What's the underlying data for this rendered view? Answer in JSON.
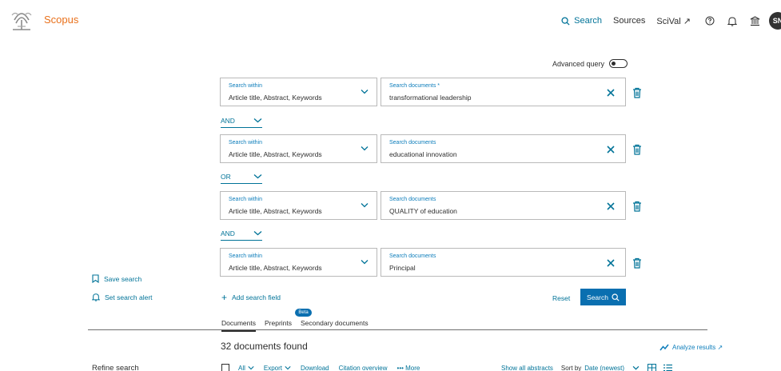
{
  "header": {
    "brand": "Scopus",
    "nav": {
      "search": "Search",
      "sources": "Sources",
      "scival": "SciVal ↗"
    },
    "avatar_initials": "SN"
  },
  "advanced_query": {
    "label": "Advanced query",
    "enabled": false
  },
  "rows": [
    {
      "within_label": "Search within",
      "within_value": "Article title, Abstract, Keywords",
      "docs_label": "Search documents *",
      "docs_value": "transformational leadership"
    },
    {
      "within_label": "Search within",
      "within_value": "Article title, Abstract, Keywords",
      "docs_label": "Search documents",
      "docs_value": "educational innovation"
    },
    {
      "within_label": "Search within",
      "within_value": "Article title, Abstract, Keywords",
      "docs_label": "Search documents",
      "docs_value": "QUALITY of education"
    },
    {
      "within_label": "Search within",
      "within_value": "Article title, Abstract, Keywords",
      "docs_label": "Search documents",
      "docs_value": "Principal"
    }
  ],
  "operators": [
    "AND",
    "OR",
    "AND"
  ],
  "sidebar": {
    "save_search": "Save search",
    "set_alert": "Set search alert",
    "refine": "Refine search"
  },
  "actions": {
    "add_field": "Add search field",
    "reset": "Reset",
    "search": "Search"
  },
  "tabs": [
    {
      "label": "Documents"
    },
    {
      "label": "Preprints"
    },
    {
      "label": "Secondary documents"
    }
  ],
  "beta_badge": "Beta",
  "results": {
    "count_text": "32 documents found",
    "analyze": "Analyze results ↗"
  },
  "toolbar": {
    "all": "All",
    "export": "Export",
    "download": "Download",
    "citation_overview": "Citation overview",
    "more": "••• More",
    "show_abstracts": "Show all abstracts",
    "sort_by": "Sort by",
    "sort_value": "Date (newest)"
  },
  "colors": {
    "brand": "#e9711c",
    "link": "#007398",
    "primary": "#0a6fb0"
  }
}
